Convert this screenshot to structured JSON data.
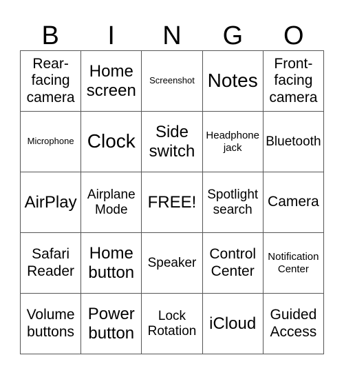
{
  "card": {
    "header": [
      "B",
      "I",
      "N",
      "G",
      "O"
    ],
    "rows": [
      [
        {
          "text": "Rear-\nfacing\ncamera",
          "size": "s-md2"
        },
        {
          "text": "Home\nscreen",
          "size": "s-lg"
        },
        {
          "text": "Screenshot",
          "size": "s-xs"
        },
        {
          "text": "Notes",
          "size": "s-xl"
        },
        {
          "text": "Front-\nfacing\ncamera",
          "size": "s-md2"
        }
      ],
      [
        {
          "text": "Microphone",
          "size": "s-xs"
        },
        {
          "text": "Clock",
          "size": "s-xl"
        },
        {
          "text": "Side\nswitch",
          "size": "s-lg"
        },
        {
          "text": "Headphone\njack",
          "size": "s-sm"
        },
        {
          "text": "Bluetooth",
          "size": "s-md"
        }
      ],
      [
        {
          "text": "AirPlay",
          "size": "s-lg"
        },
        {
          "text": "Airplane\nMode",
          "size": "s-md"
        },
        {
          "text": "FREE!",
          "size": "s-lg"
        },
        {
          "text": "Spotlight\nsearch",
          "size": "s-md"
        },
        {
          "text": "Camera",
          "size": "s-md2"
        }
      ],
      [
        {
          "text": "Safari\nReader",
          "size": "s-md2"
        },
        {
          "text": "Home\nbutton",
          "size": "s-lg"
        },
        {
          "text": "Speaker",
          "size": "s-md"
        },
        {
          "text": "Control\nCenter",
          "size": "s-md2"
        },
        {
          "text": "Notification\nCenter",
          "size": "s-sm"
        }
      ],
      [
        {
          "text": "Volume\nbuttons",
          "size": "s-md2"
        },
        {
          "text": "Power\nbutton",
          "size": "s-lg"
        },
        {
          "text": "Lock\nRotation",
          "size": "s-md"
        },
        {
          "text": "iCloud",
          "size": "s-lg"
        },
        {
          "text": "Guided\nAccess",
          "size": "s-md2"
        }
      ]
    ]
  }
}
